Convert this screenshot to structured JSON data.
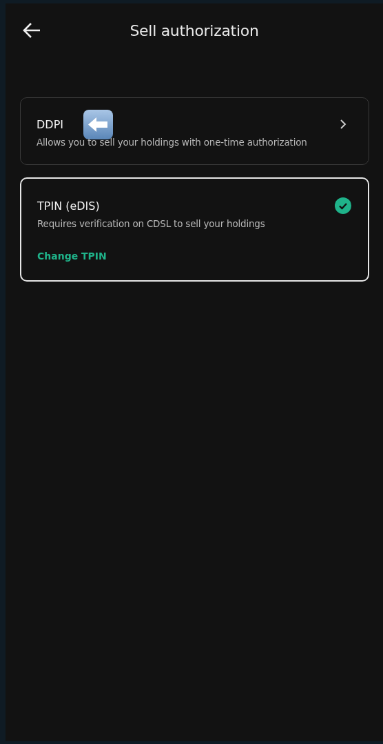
{
  "header": {
    "title": "Sell authorization"
  },
  "options": [
    {
      "title": "DDPI",
      "description": "Allows you to sell your holdings with one-time authorization",
      "selected": false,
      "annotated": true
    },
    {
      "title": "TPIN (eDIS)",
      "description": "Requires verification on CDSL to sell your holdings",
      "link": "Change TPIN",
      "selected": true,
      "annotated": false
    }
  ]
}
